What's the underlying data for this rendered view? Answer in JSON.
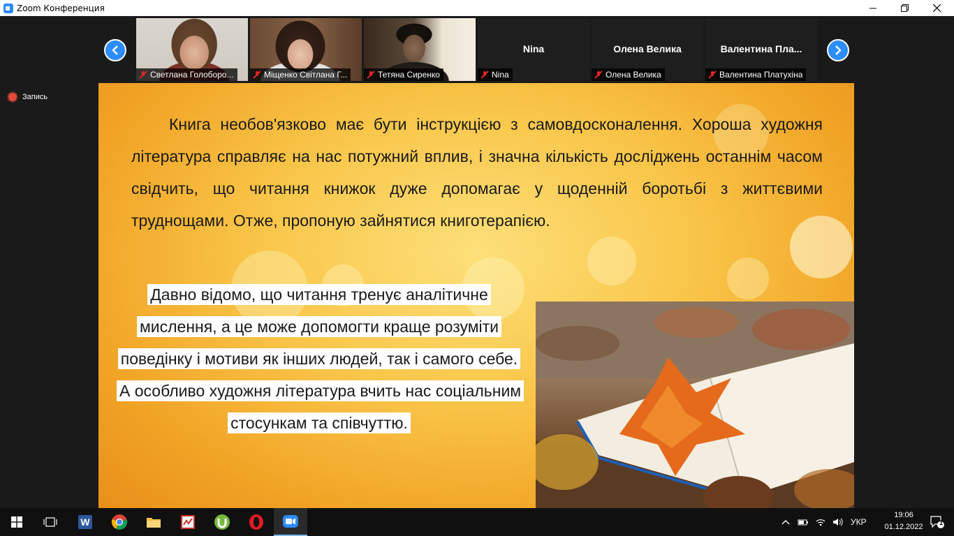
{
  "window": {
    "title": "Zoom Конференция"
  },
  "gallery": {
    "participants": [
      {
        "name": "Светлана Голоборо...",
        "label": "Светлана Голоборо...",
        "has_video": true
      },
      {
        "name": "Міщенко Світлана Г...",
        "label": "Міщенко Світлана Г...",
        "has_video": true
      },
      {
        "name": "Тетяна Сиренко",
        "label": "Тетяна Сиренко",
        "has_video": true
      },
      {
        "name": "Nina",
        "label": "Nina",
        "has_video": false
      },
      {
        "name": "Олена Велика",
        "label": "Олена Велика",
        "has_video": false
      },
      {
        "name": "Валентина  Пла...",
        "label": "Валентина Платухіна",
        "has_video": false
      }
    ]
  },
  "recording": {
    "label": "Запись"
  },
  "slide": {
    "paragraph1": "Книга необов'язково має бути інструкцією з самовдосконалення. Хороша художня література справляє на нас потужний вплив, і значна кількість досліджень останнім часом свідчить, що читання книжок дуже допомагає у щоденній боротьбі з життєвими труднощами. Отже, пропоную зайнятися книготерапією.",
    "paragraph2": "Давно відомо, що читання тренує аналітичне мислення, а це може допомогти краще розуміти поведінку і мотиви як інших людей, так і самого себе. А особливо художня література вчить нас соціальним стосункам та співчуттю."
  },
  "taskbar": {
    "language": "УКР",
    "time": "19:06",
    "date": "01.12.2022",
    "notifications_count": "1"
  },
  "colors": {
    "zoom_blue": "#2d8cff",
    "muted_red": "#e02828"
  }
}
